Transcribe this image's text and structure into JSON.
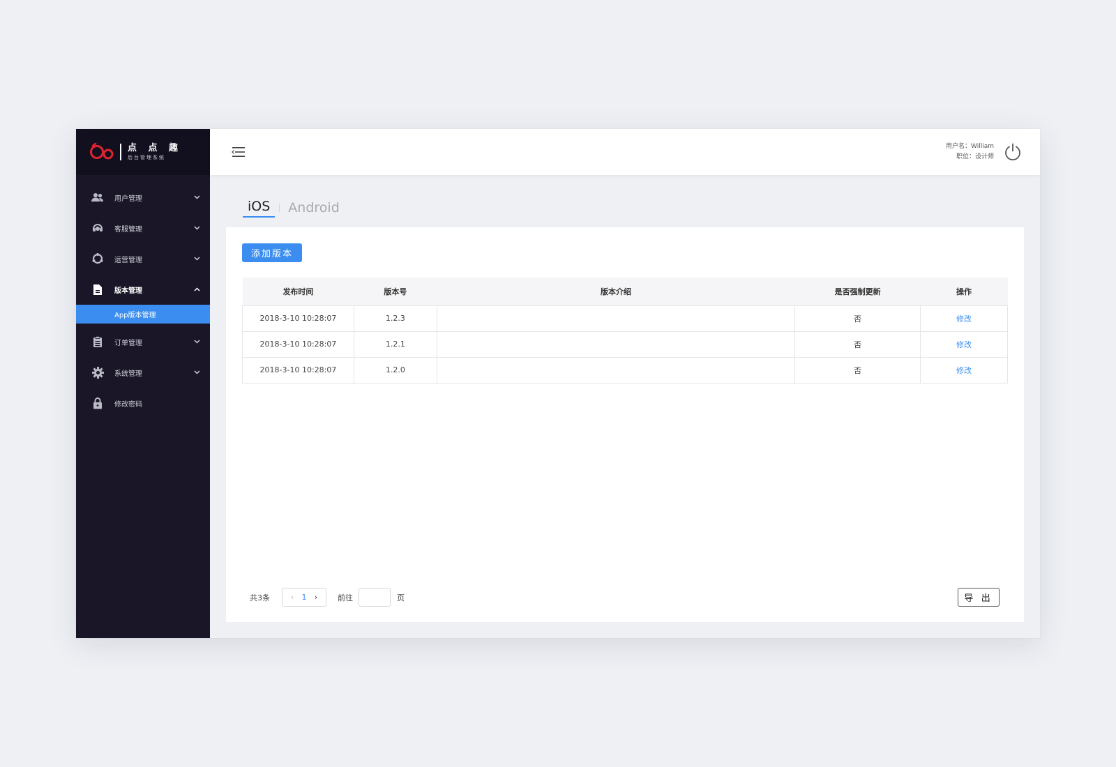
{
  "brand": {
    "name": "点 点 趣",
    "subtitle": "后台管理系统",
    "logo_color": "#e0232e"
  },
  "sidebar": {
    "items": [
      {
        "label": "用户管理",
        "icon": "users-icon"
      },
      {
        "label": "客服管理",
        "icon": "headset-icon"
      },
      {
        "label": "运营管理",
        "icon": "shield-icon"
      },
      {
        "label": "版本管理",
        "icon": "document-icon",
        "open": true
      },
      {
        "label": "订单管理",
        "icon": "clipboard-icon"
      },
      {
        "label": "系统管理",
        "icon": "gear-icon"
      },
      {
        "label": "修改密码",
        "icon": "lock-icon"
      }
    ],
    "submenu": {
      "label": "App版本管理"
    }
  },
  "header": {
    "user_line": "用户名：William",
    "role_line": "职位：设计师"
  },
  "tabs": [
    {
      "label": "iOS",
      "active": true
    },
    {
      "label": "Android",
      "active": false
    }
  ],
  "toolbar": {
    "add_label": "添加版本"
  },
  "table": {
    "headers": [
      "发布时间",
      "版本号",
      "版本介绍",
      "是否强制更新",
      "操作"
    ],
    "rows": [
      {
        "time": "2018-3-10  10:28:07",
        "version": "1.2.3",
        "intro": "",
        "force": "否",
        "action": "修改"
      },
      {
        "time": "2018-3-10  10:28:07",
        "version": "1.2.1",
        "intro": "",
        "force": "否",
        "action": "修改"
      },
      {
        "time": "2018-3-10  10:28:07",
        "version": "1.2.0",
        "intro": "",
        "force": "否",
        "action": "修改"
      }
    ]
  },
  "pagination": {
    "total": "共3条",
    "prev": "‹",
    "current": "1",
    "next": "›",
    "goto_label": "前往",
    "goto_value": "",
    "page_suffix": "页"
  },
  "export_label": "导 出",
  "colors": {
    "accent": "#3b8ef0",
    "sidebar": "#1a1628",
    "sidebar_header": "#120f1e"
  }
}
